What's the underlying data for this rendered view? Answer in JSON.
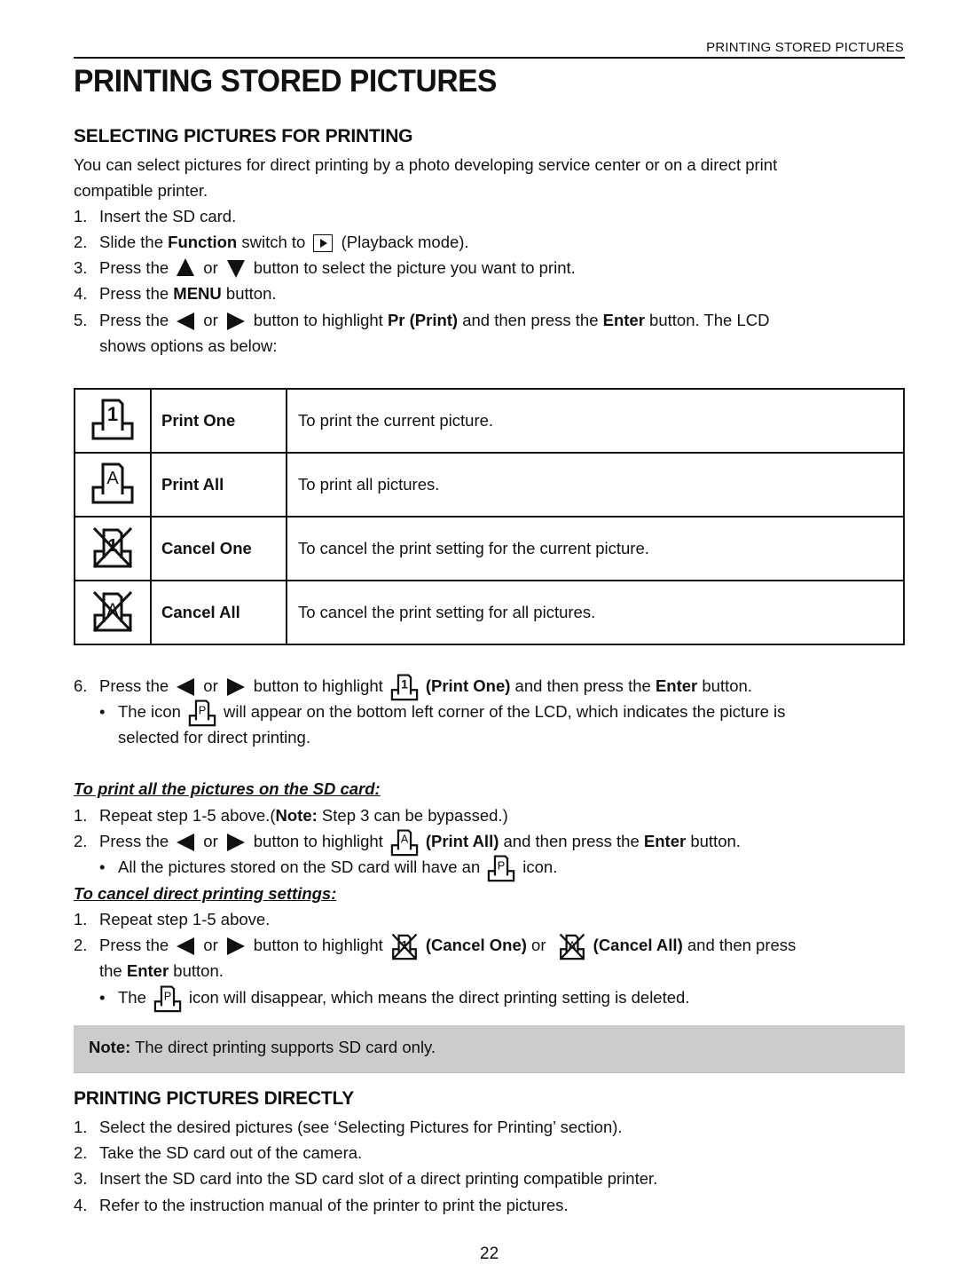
{
  "header": {
    "running_title": "PRINTING STORED PICTURES"
  },
  "page_title": "PRINTING STORED PICTURES",
  "section1": {
    "title": "SELECTING PICTURES FOR PRINTING",
    "intro_line1": "You can select pictures for direct printing by a photo developing service center or on a direct print",
    "intro_line2": "compatible printer.",
    "steps": [
      {
        "num": "1.",
        "text": "Insert the SD card."
      },
      {
        "num": "2.",
        "pre": "Slide the ",
        "bold": "Function",
        "mid": " switch to ",
        "icon": "playback-icon",
        "post": " (Playback mode)."
      },
      {
        "num": "3.",
        "pre": "Press the ",
        "icon1": "up-arrow-icon",
        "or": "or",
        "icon2": "down-arrow-icon",
        "post": "button to select the picture you want to print."
      },
      {
        "num": "4.",
        "pre": "Press the ",
        "bold": "MENU",
        "post": " button."
      },
      {
        "num": "5.",
        "pre": "Press the ",
        "icon1": "left-arrow-icon",
        "or": "or",
        "icon2": "right-arrow-icon",
        "mid": "button to highlight ",
        "bold1": "Pr (Print)",
        "mid2": " and then press the ",
        "bold2": "Enter",
        "post": " button. The LCD",
        "cont": "shows options as below:"
      }
    ]
  },
  "options_table": [
    {
      "icon": "print-one-icon",
      "name": "Print One",
      "desc": "To print the current picture."
    },
    {
      "icon": "print-all-icon",
      "name": "Print All",
      "desc": "To print all pictures."
    },
    {
      "icon": "cancel-one-icon",
      "name": "Cancel One",
      "desc": "To cancel the print setting for the current picture."
    },
    {
      "icon": "cancel-all-icon",
      "name": "Cancel All",
      "desc": "To cancel the print setting for all pictures."
    }
  ],
  "step6": {
    "num": "6.",
    "pre": "Press the ",
    "or": "or",
    "mid": "button to highlight",
    "bold1": "(Print One)",
    "mid2": " and then press the ",
    "bold2": "Enter",
    "post": " button.",
    "bullet_pre": "The icon",
    "bullet_post": "will appear on the bottom left corner of the LCD, which indicates the picture is",
    "bullet_cont": "selected for direct printing."
  },
  "print_all": {
    "subhead": "To print all the pictures on the SD card: ",
    "step1": {
      "num": "1.",
      "pre": "Repeat step 1-5 above.(",
      "bold": "Note:",
      "post": " Step 3 can be bypassed.)"
    },
    "step2": {
      "num": "2.",
      "pre": "Press the ",
      "or": "or",
      "mid": "button to highlight",
      "bold1": "(Print All)",
      "mid2": " and then press the ",
      "bold2": "Enter",
      "post": " button."
    },
    "bullet_pre": "All the pictures stored on the SD card will have an",
    "bullet_post": "icon."
  },
  "cancel": {
    "subhead": "To cancel direct printing settings:",
    "step1": {
      "num": "1.",
      "text": "Repeat step 1-5 above."
    },
    "step2": {
      "num": "2.",
      "pre": "Press the ",
      "or": "or",
      "mid": "button to highlight",
      "bold1": "(Cancel One)",
      "or2": " or ",
      "bold2": "(Cancel All)",
      "post": " and then press",
      "cont_pre": "the ",
      "cont_bold": "Enter",
      "cont_post": " button."
    },
    "bullet_pre": "The",
    "bullet_post": "icon will disappear, which means the direct printing setting is deleted."
  },
  "note": {
    "label": "Note:",
    "text": " The direct printing supports SD card only."
  },
  "section2": {
    "title": "PRINTING PICTURES DIRECTLY",
    "steps": [
      {
        "num": "1.",
        "text": "Select the desired pictures (see ‘Selecting Pictures for Printing’ section)."
      },
      {
        "num": "2.",
        "text": "Take the SD card out of the camera."
      },
      {
        "num": "3.",
        "text": "Insert the SD card into the SD card slot of a direct printing compatible printer."
      },
      {
        "num": "4.",
        "text": "Refer to the instruction manual of the printer to print the pictures."
      }
    ]
  },
  "page_number": "22",
  "icon_glyphs": {
    "print_one": "1",
    "print_all": "A",
    "printed_mark": "P"
  }
}
